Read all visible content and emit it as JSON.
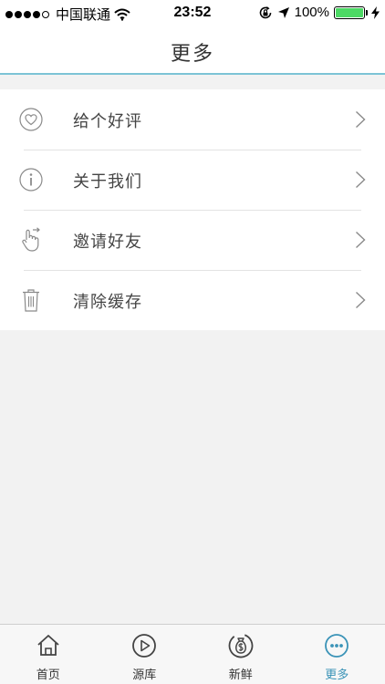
{
  "status_bar": {
    "carrier": "中国联通",
    "time": "23:52",
    "battery_text": "100%",
    "battery_level": 1.0,
    "battery_color": "#4cd964",
    "icons": [
      "wifi-icon",
      "rotation-lock-icon",
      "location-arrow-icon",
      "battery-icon",
      "charging-bolt-icon"
    ]
  },
  "header": {
    "title": "更多"
  },
  "menu": {
    "items": [
      {
        "label": "给个好评",
        "icon": "heart-icon"
      },
      {
        "label": "关于我们",
        "icon": "info-icon"
      },
      {
        "label": "邀请好友",
        "icon": "hand-pointer-icon"
      },
      {
        "label": "清除缓存",
        "icon": "trash-icon"
      }
    ]
  },
  "tabbar": {
    "accent_color": "#3a93b7",
    "tabs": [
      {
        "label": "首页",
        "icon": "home-icon",
        "active": false
      },
      {
        "label": "源库",
        "icon": "play-circle-icon",
        "active": false
      },
      {
        "label": "新鲜",
        "icon": "money-bag-icon",
        "active": false
      },
      {
        "label": "更多",
        "icon": "more-dots-icon",
        "active": true
      }
    ]
  }
}
